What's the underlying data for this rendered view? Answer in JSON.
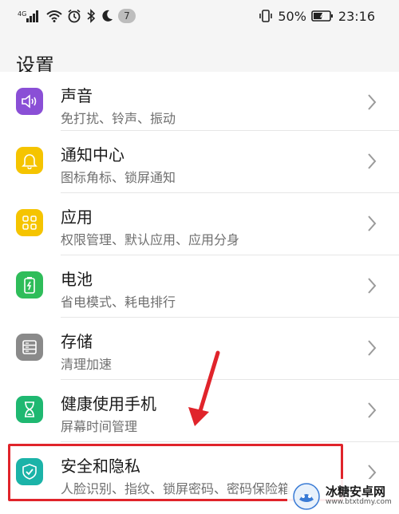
{
  "status_bar": {
    "network": "4G",
    "notification_count": "7",
    "battery": "50%",
    "time": "23:16"
  },
  "header": {
    "title": "设置"
  },
  "rows": [
    {
      "title": "声音",
      "subtitle": "免打扰、铃声、振动",
      "icon": "speaker-icon",
      "color": "#8a4fd6"
    },
    {
      "title": "通知中心",
      "subtitle": "图标角标、锁屏通知",
      "icon": "bell-icon",
      "color": "#f5c400"
    },
    {
      "title": "应用",
      "subtitle": "权限管理、默认应用、应用分身",
      "icon": "apps-grid-icon",
      "color": "#f5c400"
    },
    {
      "title": "电池",
      "subtitle": "省电模式、耗电排行",
      "icon": "battery-icon",
      "color": "#2fbd5a"
    },
    {
      "title": "存储",
      "subtitle": "清理加速",
      "icon": "storage-icon",
      "color": "#8a8a8a"
    },
    {
      "title": "健康使用手机",
      "subtitle": "屏幕时间管理",
      "icon": "hourglass-icon",
      "color": "#1fb871"
    },
    {
      "title": "安全和隐私",
      "subtitle": "人脸识别、指纹、锁屏密码、密码保险箱",
      "icon": "shield-icon",
      "color": "#1bb3a8"
    }
  ],
  "annotation": {
    "highlight_color": "#e0242b"
  },
  "watermark": {
    "name": "冰糖安卓网",
    "url": "www.btxtdmy.com"
  }
}
